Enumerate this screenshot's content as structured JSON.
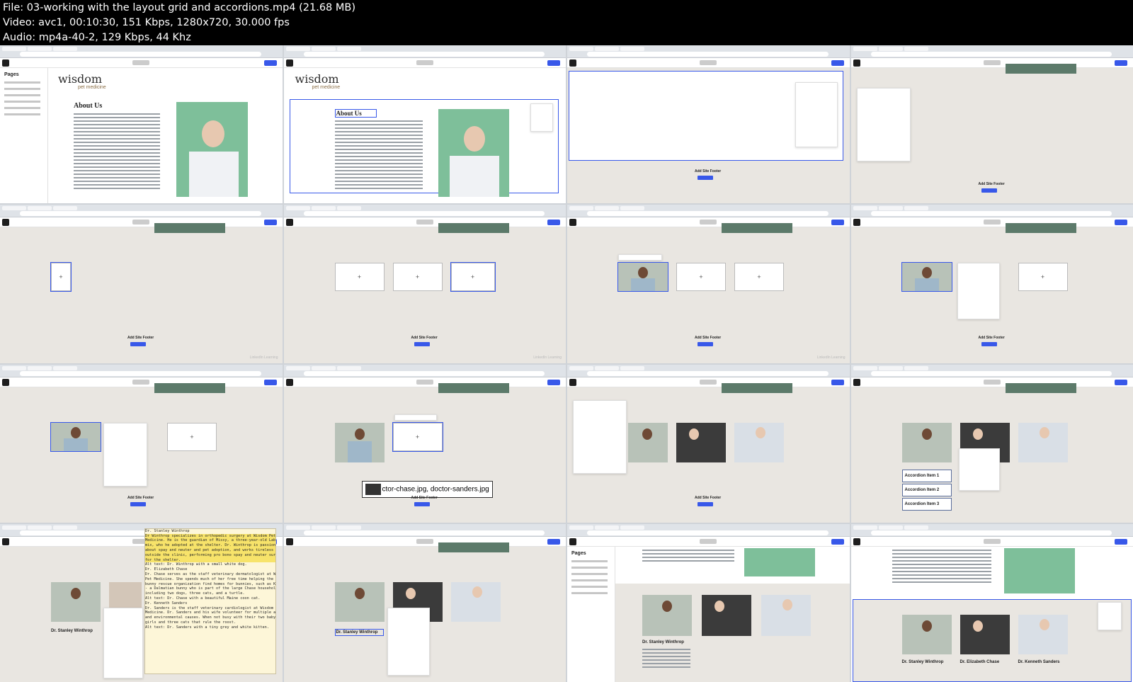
{
  "header": {
    "file_line": "File: 03-working with the layout grid and accordions.mp4 (21.68 MB)",
    "video_line": "Video: avc1, 00:10:30, 151 Kbps, 1280x720, 30.000 fps",
    "audio_line": "Audio: mp4a-40-2, 129 Kbps, 44 Khz"
  },
  "site": {
    "logo": "wisdom",
    "logo_sub": "pet medicine",
    "about_title": "About Us",
    "pages_title": "Pages",
    "watermark": "LinkedIn Learning"
  },
  "footer": {
    "label": "Add Site Footer"
  },
  "thumb7": {
    "caption_file": "ctor-chase.jpg, doctor-sanders.jpg"
  },
  "thumb12": {
    "accordion_items": [
      "Accordion Item 1",
      "Accordion Item 2",
      "Accordion Item 3"
    ]
  },
  "thumb13": {
    "name": "Dr. Stanley Winthrop",
    "code_lines": [
      "Dr. Stanley Winthrop",
      "Dr Winthrop specializes in orthopedic surgery at Wisdom Pet",
      "Medicine. He is the guardian of Missy, a three-year-old Lab",
      "mix, who he adopted at the shelter. Dr. Winthrop is passionate",
      "about spay and neuter and pet adoption, and works tireless hours",
      "outside the clinic, performing pro bono spay and neuter surgeries",
      "for the shelter.",
      "",
      "Alt text: Dr. Winthrop with a small white dog.",
      "",
      "Dr. Elizabeth Chase",
      "Dr. Chase serves as the staff veterinary dermatologist at Wisdom",
      "Pet Medicine. She spends much of her free time helping the local",
      "bunny rescue organization find homes for bunnies, such as Kibbles",
      "- a Dalmatian bunny who is part of the large Chase household,",
      "including two dogs, three cats, and a turtle.",
      "",
      "Alt text: Dr. Chase with a beautiful Maine coon cat.",
      "",
      "Dr. Kenneth Sanders",
      "Dr. Sanders is the staff veterinary cardiologist at Wisdom Pet",
      "Medicine. Dr. Sanders and his wife volunteer for multiple animal",
      "and environmental causes. When not busy with their two baby",
      "girls and three cats that rule the roost.",
      "",
      "Alt text: Dr. Sanders with a tiny grey and white kitten."
    ]
  },
  "thumb14": {
    "name": "Dr. Stanley Winthrop"
  },
  "thumb15": {
    "name": "Dr. Stanley Winthrop"
  },
  "thumb16": {
    "names": [
      "Dr. Stanley Winthrop",
      "Dr. Elizabeth Chase",
      "Dr. Kenneth Sanders"
    ]
  }
}
